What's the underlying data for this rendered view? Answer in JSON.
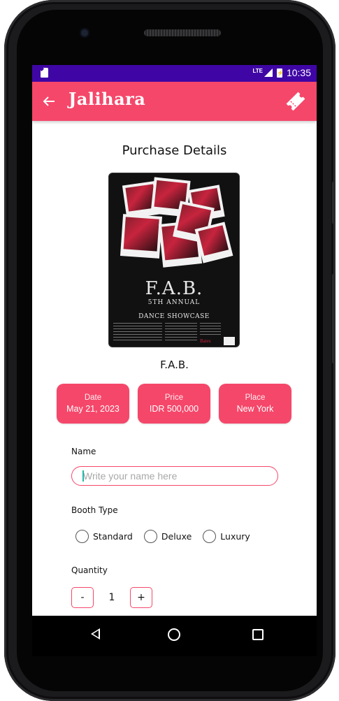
{
  "status_bar": {
    "network": "LTE",
    "time": "10:35"
  },
  "app_bar": {
    "title": "Jalihara",
    "back_icon": "arrow-left-icon",
    "action_icon": "ticket-icon"
  },
  "page": {
    "title": "Purchase Details"
  },
  "poster": {
    "title_line1": "F.A.B.",
    "title_line2": "5TH ANNUAL",
    "title_line3": "DANCE SHOWCASE",
    "footer_brand": "Bates"
  },
  "event": {
    "name": "F.A.B.",
    "date_label": "Date",
    "date_value": "May 21, 2023",
    "price_label": "Price",
    "price_value": "IDR 500,000",
    "place_label": "Place",
    "place_value": "New York"
  },
  "form": {
    "name_label": "Name",
    "name_placeholder": "Write your name here",
    "booth_label": "Booth Type",
    "booth_options": [
      "Standard",
      "Deluxe",
      "Luxury"
    ],
    "quantity_label": "Quantity",
    "quantity_minus": "-",
    "quantity_value": "1",
    "quantity_plus": "+"
  },
  "colors": {
    "status_bar": "#3f06a5",
    "accent": "#f5476a"
  }
}
